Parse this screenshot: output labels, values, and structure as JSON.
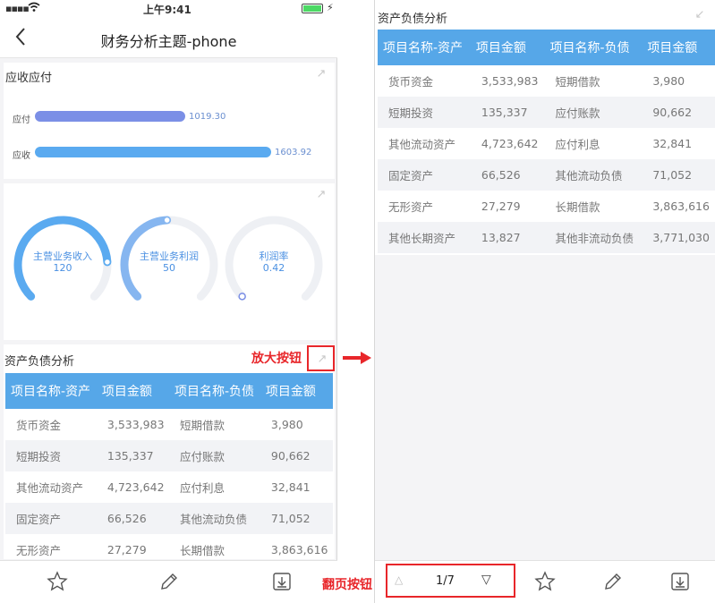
{
  "status": {
    "time": "上午9:41"
  },
  "nav": {
    "title": "财务分析主题-phone"
  },
  "ar_ap": {
    "title": "应收应付",
    "bars": [
      {
        "label": "应付",
        "value": 1019.3,
        "display": "1019.30",
        "color": "#7b8fe6"
      },
      {
        "label": "应收",
        "value": 1603.92,
        "display": "1603.92",
        "color": "#5aaaf0"
      }
    ]
  },
  "gauges": [
    {
      "label": "主营业务收入",
      "value": "120",
      "fraction": 0.82,
      "color": "#5aaaf0"
    },
    {
      "label": "主营业务利润",
      "value": "50",
      "fraction": 0.49,
      "color": "#86b6f0"
    },
    {
      "label": "利润率",
      "value": "0.42",
      "fraction": 0.0,
      "color": "#7b8fe6"
    }
  ],
  "balance": {
    "title": "资产负债分析",
    "headers": [
      "项目名称-资产",
      "项目金额",
      "项目名称-负债",
      "项目金额"
    ],
    "rows": [
      [
        "货币资金",
        "3,533,983",
        "短期借款",
        "3,980"
      ],
      [
        "短期投资",
        "135,337",
        "应付账款",
        "90,662"
      ],
      [
        "其他流动资产",
        "4,723,642",
        "应付利息",
        "32,841"
      ],
      [
        "固定资产",
        "66,526",
        "其他流动负债",
        "71,052"
      ],
      [
        "无形资产",
        "27,279",
        "长期借款",
        "3,863,616"
      ],
      [
        "其他长期资产",
        "13,827",
        "其他非流动负债",
        "3,771,030"
      ]
    ]
  },
  "annotations": {
    "zoom_button": "放大按钮",
    "page_button": "翻页按钮"
  },
  "pager": {
    "label": "1/7"
  },
  "colors": {
    "accent": "#56a7e8",
    "annotation": "#e8262a"
  }
}
